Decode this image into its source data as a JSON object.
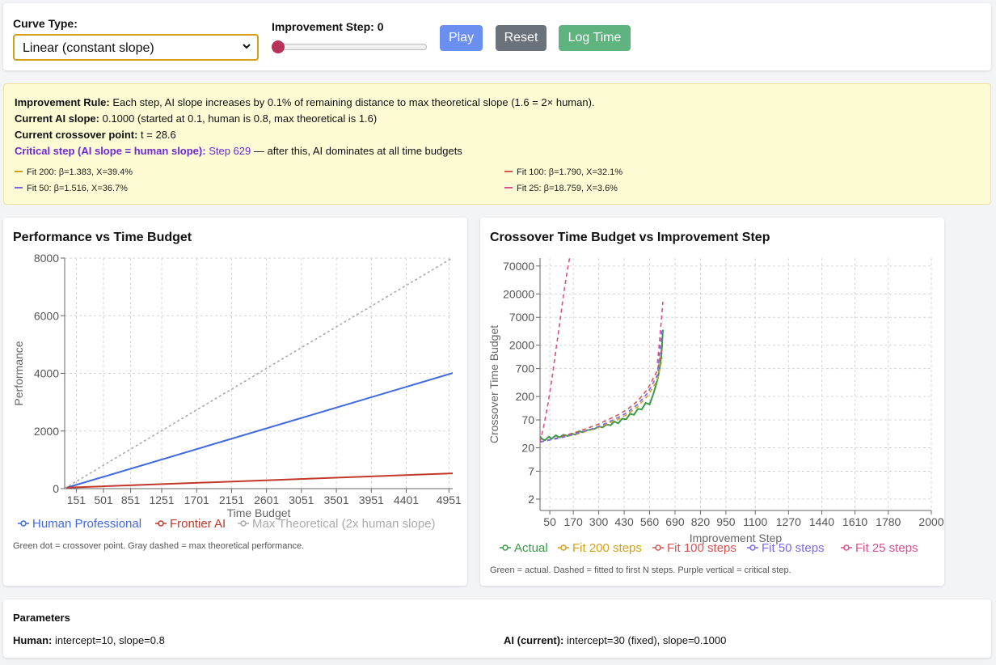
{
  "controls": {
    "curve_type_label": "Curve Type:",
    "curve_type_value": "Linear (constant slope)",
    "improvement_step_label": "Improvement Step: 0",
    "slider_value": 0,
    "play_label": "Play",
    "reset_label": "Reset",
    "log_time_label": "Log Time"
  },
  "info": {
    "rule_label": "Improvement Rule:",
    "rule_text": " Each step, AI slope increases by 0.1% of remaining distance to max theoretical slope (1.6 = 2× human).",
    "slope_label": "Current AI slope:",
    "slope_text": " 0.1000 (started at 0.1, human is 0.8, max theoretical is 1.6)",
    "crossover_label": "Current crossover point:",
    "crossover_text": " t = 28.6",
    "critical_label": "Critical step (AI slope = human slope):",
    "critical_step": " Step 629",
    "critical_text": " — after this, AI dominates at all time budgets",
    "fits": [
      {
        "label": "Fit 200: β=1.383, X=39.4%",
        "color": "#d4a017"
      },
      {
        "label": "Fit 100: β=1.790, X=32.1%",
        "color": "#d9534f"
      },
      {
        "label": "Fit 50: β=1.516, X=36.7%",
        "color": "#7b68ee"
      },
      {
        "label": "Fit 25: β=18.759, X=3.6%",
        "color": "#d94f8c"
      }
    ]
  },
  "left_panel": {
    "title": "Performance vs Time Budget",
    "caption": "Green dot = crossover point. Gray dashed = max theoretical performance."
  },
  "right_panel": {
    "title": "Crossover Time Budget vs Improvement Step",
    "caption": "Green = actual. Dashed = fitted to first N steps. Purple vertical = critical step."
  },
  "params": {
    "title": "Parameters",
    "human_label": "Human:",
    "human_text": " intercept=10, slope=0.8",
    "ai_label": "AI (current):",
    "ai_text": " intercept=30 (fixed), slope=0.1000"
  },
  "chart_data": [
    {
      "type": "line",
      "title": "Performance vs Time Budget",
      "xlabel": "Time Budget",
      "ylabel": "Performance",
      "xlim": [
        1,
        5000
      ],
      "ylim": [
        0,
        8000
      ],
      "x_ticks": [
        "151",
        "501",
        "851",
        "1251",
        "1701",
        "2151",
        "2601",
        "3051",
        "3501",
        "3951",
        "4401",
        "4951"
      ],
      "y_ticks": [
        "0",
        "2000",
        "4000",
        "6000",
        "8000"
      ],
      "grid": true,
      "legend": "bottom",
      "series": [
        {
          "name": "Human Professional",
          "color": "#4169e1",
          "dashed": false,
          "x": [
            1,
            5000
          ],
          "y": [
            10.8,
            4010
          ]
        },
        {
          "name": "Frontier AI",
          "color": "#c0392b",
          "dashed": false,
          "x": [
            1,
            5000
          ],
          "y": [
            30.1,
            530
          ]
        },
        {
          "name": "Max Theoretical (2x human slope)",
          "color": "#aaaaaa",
          "dashed": true,
          "x": [
            1,
            5000
          ],
          "y": [
            11.6,
            8010
          ]
        }
      ]
    },
    {
      "type": "line",
      "title": "Crossover Time Budget vs Improvement Step",
      "xlabel": "Improvement Step",
      "ylabel": "Crossover Time Budget",
      "y_scale": "log",
      "xlim": [
        0,
        2000
      ],
      "ylim": [
        1.2,
        100000
      ],
      "x_ticks": [
        "50",
        "170",
        "300",
        "430",
        "560",
        "690",
        "820",
        "950",
        "1100",
        "1270",
        "1440",
        "1610",
        "1780",
        "2000"
      ],
      "y_ticks": [
        "2",
        "7",
        "20",
        "70",
        "200",
        "700",
        "2000",
        "7000",
        "20000",
        "70000"
      ],
      "grid": true,
      "legend": "bottom",
      "series": [
        {
          "name": "Actual",
          "color": "#3a9a48",
          "dashed": false,
          "x": [
            0,
            10,
            25,
            45,
            60,
            80,
            100,
            120,
            140,
            160,
            180,
            200,
            220,
            240,
            260,
            280,
            300,
            320,
            340,
            360,
            380,
            400,
            420,
            440,
            460,
            480,
            500,
            520,
            540,
            560,
            580,
            600,
            610,
            620,
            628
          ],
          "y": [
            33,
            30,
            28,
            33,
            30,
            35,
            32,
            36,
            34,
            38,
            36,
            42,
            40,
            44,
            45,
            47,
            52,
            50,
            57,
            55,
            65,
            60,
            74,
            72,
            92,
            88,
            115,
            112,
            150,
            140,
            230,
            420,
            650,
            1200,
            4000
          ]
        },
        {
          "name": "Fit 200 steps",
          "color": "#d4a017",
          "dashed": true,
          "x": [
            0,
            100,
            200,
            300,
            400,
            450,
            500,
            550,
            600,
            625
          ],
          "y": [
            26,
            31,
            38,
            50,
            72,
            92,
            128,
            205,
            420,
            1150
          ]
        },
        {
          "name": "Fit 100 steps",
          "color": "#d9534f",
          "dashed": true,
          "x": [
            0,
            100,
            200,
            300,
            400,
            450,
            500,
            550,
            600,
            625
          ],
          "y": [
            26,
            32,
            42,
            58,
            88,
            115,
            165,
            280,
            650,
            1950
          ]
        },
        {
          "name": "Fit 50 steps",
          "color": "#7b68ee",
          "dashed": true,
          "x": [
            0,
            100,
            200,
            300,
            400,
            450,
            500,
            550,
            600,
            625
          ],
          "y": [
            26,
            31,
            39,
            52,
            78,
            100,
            142,
            235,
            520,
            4500
          ]
        },
        {
          "name": "Fit 25 steps",
          "color": "#d94f8c",
          "dashed": true,
          "x": [
            0,
            20,
            40,
            60,
            80,
            100,
            120,
            140,
            160
          ],
          "y": [
            26,
            55,
            140,
            420,
            1500,
            5200,
            19000,
            60000,
            150000
          ]
        },
        {
          "name": "Fit 25 steps (right tail)",
          "color": "#d94f8c",
          "dashed": true,
          "legend": false,
          "x": [
            600,
            610,
            620,
            628
          ],
          "y": [
            900,
            2200,
            6000,
            14000
          ]
        }
      ]
    }
  ]
}
